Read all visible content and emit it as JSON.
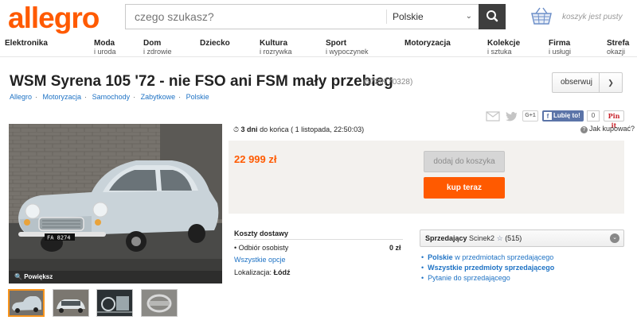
{
  "header": {
    "logo": "allegro",
    "search_placeholder": "czego szukasz?",
    "search_category": "Polskie",
    "cart_text": "koszyk jest pusty"
  },
  "categories": [
    {
      "main": "Elektronika",
      "sub": ""
    },
    {
      "main": "Moda",
      "sub": "i uroda"
    },
    {
      "main": "Dom",
      "sub": "i zdrowie"
    },
    {
      "main": "Dziecko",
      "sub": ""
    },
    {
      "main": "Kultura",
      "sub": "i rozrywka"
    },
    {
      "main": "Sport",
      "sub": "i wypoczynek"
    },
    {
      "main": "Motoryzacja",
      "sub": ""
    },
    {
      "main": "Kolekcje",
      "sub": "i sztuka"
    },
    {
      "main": "Firma",
      "sub": "i usługi"
    },
    {
      "main": "Strefa",
      "sub": "okazji"
    }
  ],
  "offer": {
    "title": "WSM Syrena 105 '72 - nie FSO ani FSM mały przebieg",
    "id": "(5739770328)",
    "watch_label": "obserwuj",
    "breadcrumb": [
      "Allegro",
      "Motoryzacja",
      "Samochody",
      "Zabytkowe",
      "Polskie"
    ],
    "time_left_bold": "3 dni",
    "time_left_rest": " do końca  ( 1 listopada, 22:50:03)",
    "price": "22 999 zł",
    "add_to_cart": "dodaj do koszyka",
    "buy_now": "kup teraz",
    "zoom_label": "Powiększ",
    "help_label": "Jak kupować?"
  },
  "share": {
    "gplus": "G+1",
    "like": "Lubię to!",
    "like_count": "0",
    "pinit": "Pin it"
  },
  "shipping": {
    "title": "Koszty dostawy",
    "pickup_label": "Odbiór osobisty",
    "pickup_price": "0 zł",
    "all_options": "Wszystkie opcje",
    "location_label": "Lokalizacja:",
    "location_value": "Łódź"
  },
  "seller": {
    "label": "Sprzedający",
    "nick": "Scinek2",
    "rating": "(515)",
    "links": [
      {
        "bold": "Polskie",
        "rest": " w przedmiotach sprzedającego"
      },
      {
        "bold": "Wszystkie przedmioty sprzedającego",
        "rest": ""
      },
      {
        "bold": "",
        "rest": "Pytanie do sprzedającego"
      }
    ]
  },
  "colors": {
    "accent": "#ff5a00",
    "link": "#1e72c4"
  }
}
